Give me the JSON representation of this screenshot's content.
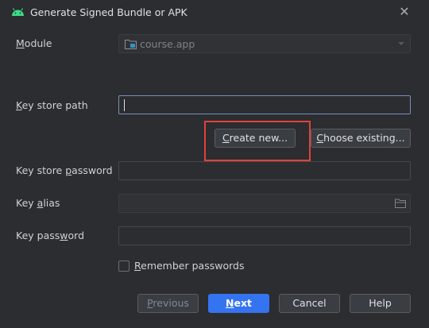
{
  "window": {
    "title": "Generate Signed Bundle or APK",
    "close_glyph": "✕"
  },
  "module": {
    "label_first": "M",
    "label_rest": "odule",
    "value": "course.app"
  },
  "key_store_path": {
    "label_first": "K",
    "label_rest": "ey store path",
    "value": ""
  },
  "create_new": {
    "label_first": "C",
    "label_rest": "reate new..."
  },
  "choose_existing": {
    "label_first": "C",
    "label_rest": "hoose existing..."
  },
  "key_store_password": {
    "label_pre": "Key store ",
    "label_first": "p",
    "label_rest": "assword",
    "value": ""
  },
  "key_alias": {
    "label_pre": "Key ",
    "label_first": "a",
    "label_rest": "lias",
    "value": ""
  },
  "key_password": {
    "label_pre": "Key pass",
    "label_first": "w",
    "label_rest": "ord",
    "value": ""
  },
  "remember": {
    "label_first": "R",
    "label_rest": "emember passwords",
    "checked": false
  },
  "footer": {
    "previous_first": "P",
    "previous_rest": "revious",
    "next_first": "N",
    "next_rest": "ext",
    "cancel": "Cancel",
    "help": "Help"
  },
  "icons": {
    "app": "android-icon",
    "module": "module-folder-icon",
    "browse": "browse-folder-icon",
    "close": "close-icon",
    "dropdown": "chevron-down-icon"
  },
  "colors": {
    "background": "#2b2d30",
    "accent": "#3574f0",
    "android_green": "#3ddc84",
    "highlight": "#e0433b"
  }
}
